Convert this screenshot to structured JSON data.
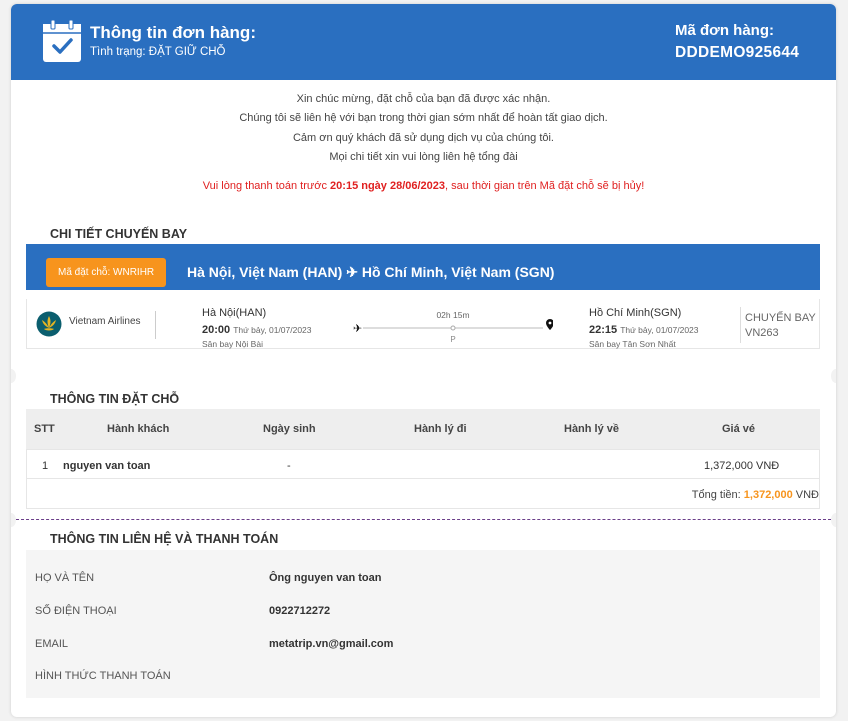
{
  "header": {
    "title": "Thông tin đơn hàng:",
    "status": "Tình trạng: ĐẶT GIỮ CHỖ",
    "order_code_label": "Mã đơn hàng:",
    "order_code": "DDDEMO925644"
  },
  "messages": [
    "Xin chúc mừng, đặt chỗ của bạn đã được xác nhận.",
    "Chúng tôi sẽ liên hệ với bạn trong thời gian sớm nhất để hoàn tất giao dịch.",
    "Cảm ơn quý khách đã sử dụng dịch vụ của chúng tôi.",
    "Mọi chi tiết xin vui lòng liên hệ tổng đài"
  ],
  "warning": {
    "prefix": "Vui lòng thanh toán trước ",
    "deadline": "20:15 ngày 28/06/2023",
    "suffix": ", sau thời gian trên Mã đặt chỗ sẽ bị hủy!"
  },
  "flight_section": {
    "title": "CHI TIẾT CHUYẾN BAY",
    "pnr_badge": "Mã đặt chỗ: WNRIHR",
    "route": "Hà Nội, Việt Nam (HAN) ✈ Hồ Chí Minh, Việt Nam (SGN)",
    "airline": "Vietnam Airlines",
    "departure": {
      "city": "Hà Nội(HAN)",
      "time": "20:00",
      "date": "Thứ bảy, 01/07/2023",
      "airport": "Sân bay Nội Bài"
    },
    "duration": "02h 15m",
    "stop_marker": "P",
    "arrival": {
      "city": "Hồ Chí Minh(SGN)",
      "time": "22:15",
      "date": "Thứ bảy, 01/07/2023",
      "airport": "Sân bay Tân Sơn Nhất"
    },
    "flight_label": "CHUYẾN BAY",
    "flight_no": "VN263"
  },
  "booking_section": {
    "title": "THÔNG TIN ĐẶT CHỖ",
    "columns": [
      "STT",
      "Hành khách",
      "Ngày sinh",
      "Hành lý đi",
      "Hành lý về",
      "Giá vé"
    ],
    "rows": [
      {
        "stt": "1",
        "passenger": "nguyen van toan",
        "dob": "-",
        "bag_out": "",
        "bag_return": "",
        "price": "1,372,000 VNĐ"
      }
    ],
    "total_label": "Tổng tiền: ",
    "total_value": "1,372,000",
    "total_currency": " VNĐ"
  },
  "contact_section": {
    "title": "THÔNG TIN LIÊN HỆ VÀ THANH TOÁN",
    "fields": [
      {
        "label": "HỌ VÀ TÊN",
        "value": "Ông nguyen van toan"
      },
      {
        "label": "SỐ ĐIỆN THOẠI",
        "value": "0922712272"
      },
      {
        "label": "EMAIL",
        "value": "metatrip.vn@gmail.com"
      },
      {
        "label": "HÌNH THỨC THANH TOÁN",
        "value": ""
      }
    ]
  },
  "colors": {
    "primary": "#2a6fc0",
    "accent": "#f7941d",
    "warning": "#e02020"
  },
  "icons": {
    "header": "calendar-check-icon",
    "airline": "vietnam-airlines-logo",
    "departure": "plane-icon",
    "arrival": "location-pin-icon"
  }
}
